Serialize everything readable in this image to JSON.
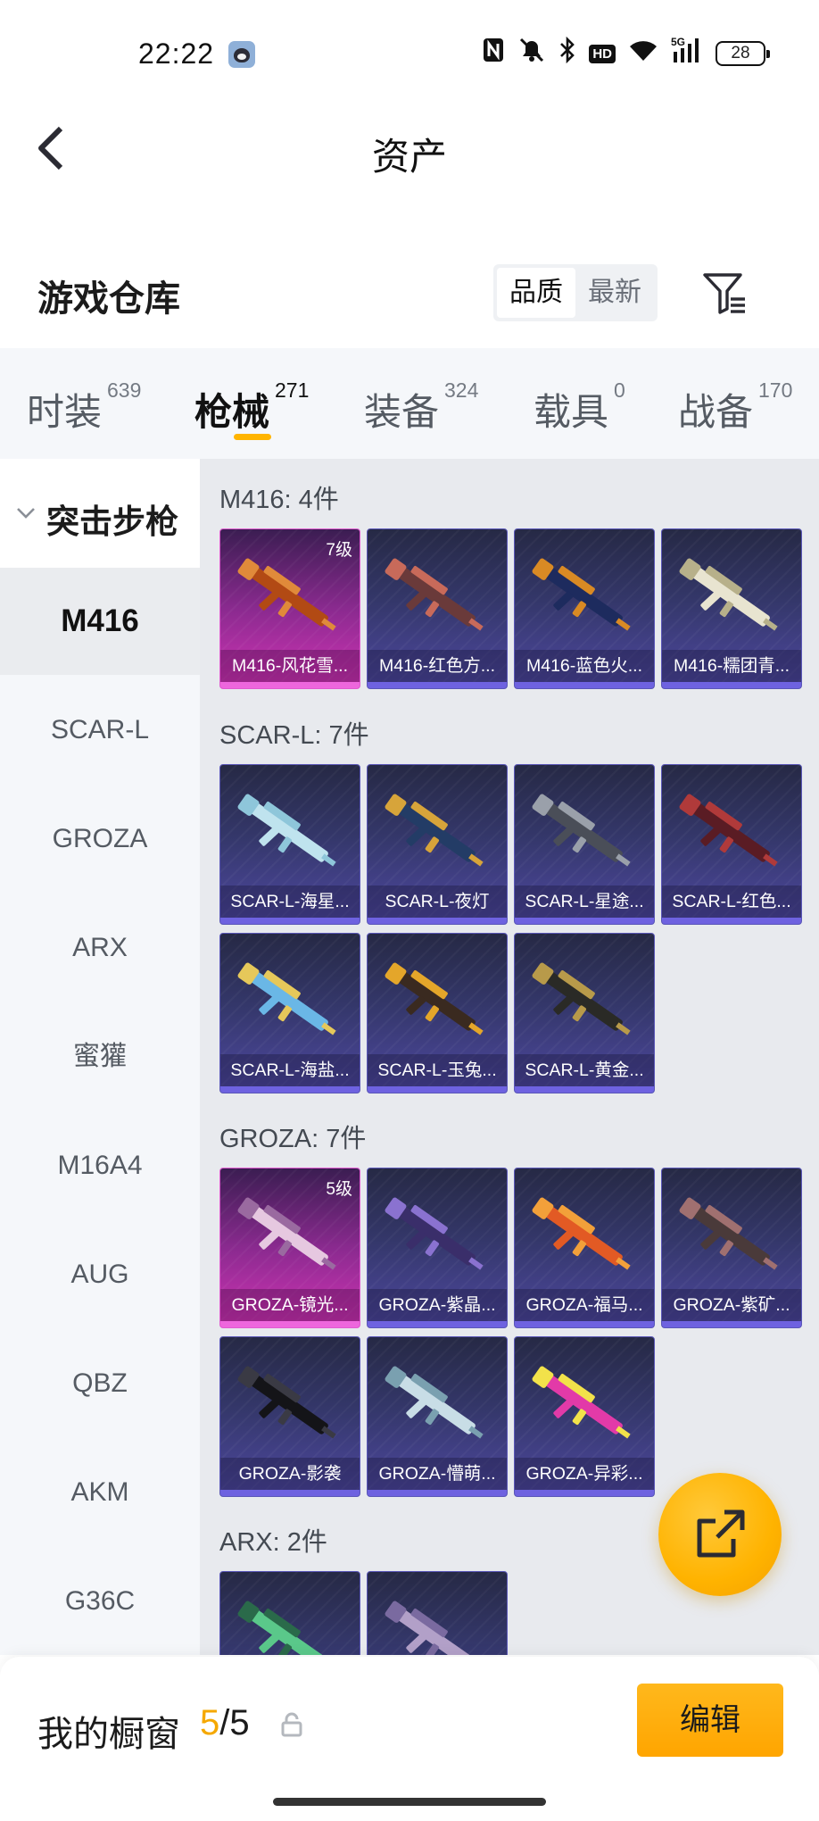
{
  "status_bar": {
    "time": "22:22",
    "icons": [
      "nfc-icon",
      "mute-icon",
      "bluetooth-icon",
      "hd-icon",
      "wifi-icon",
      "5g-signal-icon",
      "battery-icon"
    ],
    "hd_label": "HD",
    "signal_label": "5G",
    "battery": "28"
  },
  "header": {
    "title": "资产"
  },
  "warehouse": {
    "title": "游戏仓库",
    "sort_options": [
      "品质",
      "最新"
    ],
    "active_sort": "品质"
  },
  "tabs": [
    {
      "label": "时装",
      "count": "639"
    },
    {
      "label": "枪械",
      "count": "271"
    },
    {
      "label": "装备",
      "count": "324"
    },
    {
      "label": "载具",
      "count": "0"
    },
    {
      "label": "战备",
      "count": "170"
    }
  ],
  "active_tab": "枪械",
  "sidebar": {
    "group": "突击步枪",
    "items": [
      "M416",
      "SCAR-L",
      "GROZA",
      "ARX",
      "蜜獾",
      "M16A4",
      "AUG",
      "QBZ",
      "AKM",
      "G36C"
    ],
    "active": "M416"
  },
  "sections": [
    {
      "title": "M416: 4件",
      "items": [
        {
          "name": "M416-风花雪...",
          "level": "7级",
          "rarity": "pink"
        },
        {
          "name": "M416-红色方...",
          "level": "",
          "rarity": "purple"
        },
        {
          "name": "M416-蓝色火...",
          "level": "",
          "rarity": "purple"
        },
        {
          "name": "M416-糯团青...",
          "level": "",
          "rarity": "purple"
        }
      ]
    },
    {
      "title": "SCAR-L: 7件",
      "items": [
        {
          "name": "SCAR-L-海星...",
          "level": "",
          "rarity": "purple"
        },
        {
          "name": "SCAR-L-夜灯",
          "level": "",
          "rarity": "purple"
        },
        {
          "name": "SCAR-L-星途...",
          "level": "",
          "rarity": "purple"
        },
        {
          "name": "SCAR-L-红色...",
          "level": "",
          "rarity": "purple"
        },
        {
          "name": "SCAR-L-海盐...",
          "level": "",
          "rarity": "purple"
        },
        {
          "name": "SCAR-L-玉兔...",
          "level": "",
          "rarity": "purple"
        },
        {
          "name": "SCAR-L-黄金...",
          "level": "",
          "rarity": "purple"
        }
      ]
    },
    {
      "title": "GROZA: 7件",
      "items": [
        {
          "name": "GROZA-镜光...",
          "level": "5级",
          "rarity": "pink"
        },
        {
          "name": "GROZA-紫晶...",
          "level": "",
          "rarity": "purple"
        },
        {
          "name": "GROZA-福马...",
          "level": "",
          "rarity": "purple"
        },
        {
          "name": "GROZA-紫矿...",
          "level": "",
          "rarity": "purple"
        },
        {
          "name": "GROZA-影袭",
          "level": "",
          "rarity": "purple"
        },
        {
          "name": "GROZA-懵萌...",
          "level": "",
          "rarity": "purple"
        },
        {
          "name": "GROZA-异彩...",
          "level": "",
          "rarity": "purple"
        }
      ]
    },
    {
      "title": "ARX: 2件",
      "items": [
        {
          "name": "",
          "level": "",
          "rarity": "purple"
        },
        {
          "name": "",
          "level": "",
          "rarity": "purple"
        }
      ]
    }
  ],
  "gun_colors": [
    [
      "#b24a14",
      "#e08a3a"
    ],
    [
      "#6a3a3a",
      "#c86a5a"
    ],
    [
      "#1d2b5e",
      "#d98a24"
    ],
    [
      "#e8e4d0",
      "#b7b08a"
    ],
    [
      "#bfe3ee",
      "#8ec6da"
    ],
    [
      "#233c66",
      "#d7a43a"
    ],
    [
      "#4a4e58",
      "#9aa0aa"
    ],
    [
      "#5a1c24",
      "#b03a3a"
    ],
    [
      "#6ab7e6",
      "#e6c85a"
    ],
    [
      "#3a2a20",
      "#e4a62a"
    ],
    [
      "#2a2a26",
      "#b89a4a"
    ],
    [
      "#e6c8e0",
      "#9a6aa0"
    ],
    [
      "#3a2e6a",
      "#8a72d0"
    ],
    [
      "#e25a24",
      "#f2a03a"
    ],
    [
      "#4a3a3a",
      "#a07070"
    ],
    [
      "#141418",
      "#3a3a44"
    ],
    [
      "#c8dde6",
      "#7aa0b0"
    ],
    [
      "#e23aa8",
      "#f2e24a"
    ],
    [
      "#5ac88a",
      "#2a6a4a"
    ],
    [
      "#b2a0c8",
      "#7a6aa0"
    ]
  ],
  "showcase": {
    "title": "我的橱窗",
    "current": "5",
    "total": "/5",
    "edit_label": "编辑"
  },
  "colors": {
    "accent": "#ffb400",
    "pink_rarity": "#d234b5",
    "purple_rarity": "#4e48a0"
  }
}
